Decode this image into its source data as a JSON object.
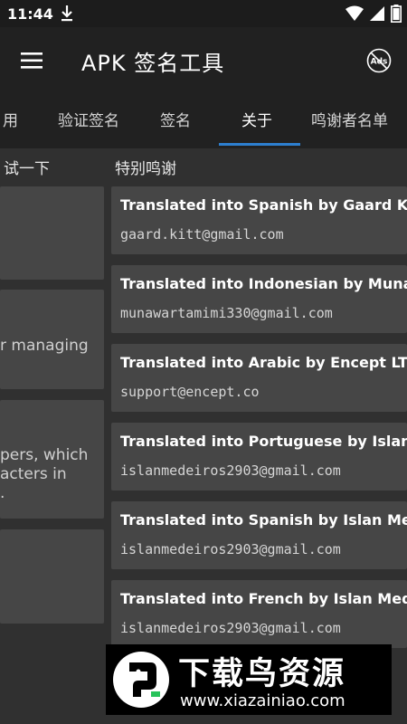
{
  "status_bar": {
    "time": "11:44",
    "icons": [
      "download-icon",
      "wifi-icon",
      "signal-icon",
      "battery-icon"
    ]
  },
  "app_bar": {
    "title": "APK 签名工具",
    "ads_label": "Ads"
  },
  "tabs": [
    {
      "label": "用"
    },
    {
      "label": "验证签名"
    },
    {
      "label": "签名"
    },
    {
      "label": "关于"
    },
    {
      "label": "鸣谢者名单"
    }
  ],
  "left_column": {
    "header": "试一下",
    "cards": [
      {
        "lines": []
      },
      {
        "lines": [
          "r managing"
        ]
      },
      {
        "lines": [
          "pers, which",
          "acters in",
          "."
        ]
      },
      {
        "lines": []
      }
    ]
  },
  "right_column": {
    "header": "特别鸣谢",
    "credits": [
      {
        "title": "Translated into Spanish by Gaard Kitt",
        "email": "gaard.kitt@gmail.com"
      },
      {
        "title": "Translated into Indonesian by Munawar",
        "email": "munawartamimi330@gmail.com"
      },
      {
        "title": "Translated into Arabic by Encept LTD",
        "email": "support@encept.co"
      },
      {
        "title": "Translated into Portuguese by Islan Med",
        "email": "islanmedeiros2903@gmail.com"
      },
      {
        "title": "Translated into Spanish by Islan Medeiro",
        "email": "islanmedeiros2903@gmail.com"
      },
      {
        "title": "Translated into French by Islan Medeiros",
        "email": "islanmedeiros2903@gmail.com"
      }
    ]
  },
  "watermark": {
    "brand": "下载鸟资源",
    "url": "www.xiazainiao.com"
  },
  "colors": {
    "background": "#303030",
    "toolbar": "#212121",
    "card": "#464646",
    "accent": "#2d7fd0"
  }
}
